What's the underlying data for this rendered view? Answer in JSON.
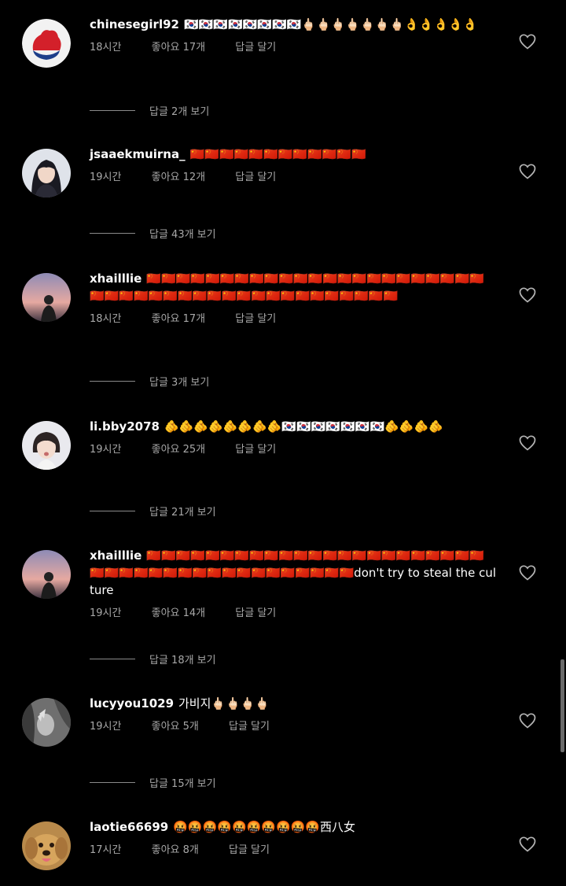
{
  "comments": [
    {
      "username": "chinesegirl92",
      "text": "🇰🇷🇰🇷🇰🇷🇰🇷🇰🇷🇰🇷🇰🇷🇰🇷🖕🏻🖕🏻🖕🏻🖕🏻🖕🏻🖕🏻🖕🏻👌👌👌👌👌",
      "time": "18시간",
      "likes": "좋아요 17개",
      "reply": "답글 달기",
      "view_replies": "답글 2개 보기",
      "avatar_icon": "red-blue-blob-avatar"
    },
    {
      "username": "jsaaekmuirna_",
      "text": "🇨🇳🇨🇳🇨🇳🇨🇳🇨🇳🇨🇳🇨🇳🇨🇳🇨🇳🇨🇳🇨🇳🇨🇳",
      "time": "19시간",
      "likes": "좋아요 12개",
      "reply": "답글 달기",
      "view_replies": "답글 43개 보기",
      "avatar_icon": "girl-portrait-avatar"
    },
    {
      "username": "xhailllie",
      "text": "🇨🇳🇨🇳🇨🇳🇨🇳🇨🇳🇨🇳🇨🇳🇨🇳🇨🇳🇨🇳🇨🇳🇨🇳🇨🇳🇨🇳🇨🇳🇨🇳🇨🇳🇨🇳🇨🇳🇨🇳🇨🇳🇨🇳🇨🇳🇨🇳🇨🇳🇨🇳🇨🇳🇨🇳🇨🇳🇨🇳🇨🇳🇨🇳🇨🇳🇨🇳🇨🇳🇨🇳🇨🇳🇨🇳🇨🇳🇨🇳🇨🇳🇨🇳🇨🇳🇨🇳",
      "time": "18시간",
      "likes": "좋아요 17개",
      "reply": "답글 달기",
      "view_replies": "답글 3개 보기",
      "avatar_icon": "sunset-silhouette-avatar"
    },
    {
      "username": "li.bby2078",
      "text": "🫵🫵🫵🫵🫵🫵🫵🫵🇰🇷🇰🇷🇰🇷🇰🇷🇰🇷🇰🇷🇰🇷🫵🫵🫵🫵",
      "time": "19시간",
      "likes": "좋아요 25개",
      "reply": "답글 달기",
      "view_replies": "답글 21개 보기",
      "avatar_icon": "child-portrait-avatar"
    },
    {
      "username": "xhailllie",
      "text": "🇨🇳🇨🇳🇨🇳🇨🇳🇨🇳🇨🇳🇨🇳🇨🇳🇨🇳🇨🇳🇨🇳🇨🇳🇨🇳🇨🇳🇨🇳🇨🇳🇨🇳🇨🇳🇨🇳🇨🇳🇨🇳🇨🇳🇨🇳🇨🇳🇨🇳🇨🇳🇨🇳🇨🇳🇨🇳🇨🇳🇨🇳🇨🇳🇨🇳🇨🇳🇨🇳🇨🇳🇨🇳🇨🇳🇨🇳🇨🇳🇨🇳don't try to steal the culture",
      "time": "19시간",
      "likes": "좋아요 14개",
      "reply": "답글 달기",
      "view_replies": "답글 18개 보기",
      "avatar_icon": "sunset-silhouette-avatar"
    },
    {
      "username": "lucyyou1029",
      "text": "가비지🖕🏻🖕🏻🖕🏻🖕🏻",
      "time": "19시간",
      "likes": "좋아요 5개",
      "reply": "답글 달기",
      "view_replies": "답글 15개 보기",
      "avatar_icon": "grayscale-hand-avatar"
    },
    {
      "username": "laotie66699",
      "text": "🤬🤬🤬🤬🤬🤬🤬🤬🤬🤬西八女",
      "time": "17시간",
      "likes": "좋아요 8개",
      "reply": "답글 달기",
      "view_replies": "",
      "avatar_icon": "golden-retriever-avatar"
    }
  ],
  "icons": {
    "like": "heart-outline-icon"
  },
  "colors": {
    "background": "#000000",
    "text": "#ffffff",
    "meta": "#a8a8a8"
  }
}
